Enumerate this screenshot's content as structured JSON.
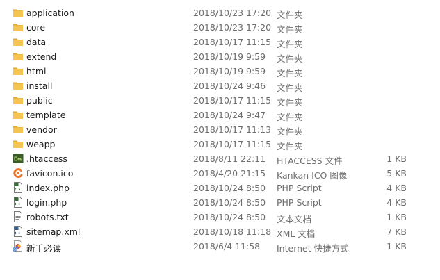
{
  "files": [
    {
      "name": "application",
      "date": "2018/10/23 17:20",
      "type": "文件夹",
      "size": "",
      "icon": "folder-icon"
    },
    {
      "name": "core",
      "date": "2018/10/23 17:20",
      "type": "文件夹",
      "size": "",
      "icon": "folder-icon"
    },
    {
      "name": "data",
      "date": "2018/10/17 11:15",
      "type": "文件夹",
      "size": "",
      "icon": "folder-icon"
    },
    {
      "name": "extend",
      "date": "2018/10/19 9:59",
      "type": "文件夹",
      "size": "",
      "icon": "folder-icon"
    },
    {
      "name": "html",
      "date": "2018/10/19 9:59",
      "type": "文件夹",
      "size": "",
      "icon": "folder-icon"
    },
    {
      "name": "install",
      "date": "2018/10/24 9:46",
      "type": "文件夹",
      "size": "",
      "icon": "folder-icon"
    },
    {
      "name": "public",
      "date": "2018/10/17 11:15",
      "type": "文件夹",
      "size": "",
      "icon": "folder-icon"
    },
    {
      "name": "template",
      "date": "2018/10/24 9:47",
      "type": "文件夹",
      "size": "",
      "icon": "folder-icon"
    },
    {
      "name": "vendor",
      "date": "2018/10/17 11:13",
      "type": "文件夹",
      "size": "",
      "icon": "folder-icon"
    },
    {
      "name": "weapp",
      "date": "2018/10/17 11:15",
      "type": "文件夹",
      "size": "",
      "icon": "folder-icon"
    },
    {
      "name": ".htaccess",
      "date": "2018/8/11 22:11",
      "type": "HTACCESS 文件",
      "size": "1 KB",
      "icon": "dreamweaver-icon"
    },
    {
      "name": "favicon.ico",
      "date": "2018/4/20 21:15",
      "type": "Kankan ICO 图像",
      "size": "5 KB",
      "icon": "kankan-icon"
    },
    {
      "name": "index.php",
      "date": "2018/10/24 8:50",
      "type": "PHP Script",
      "size": "4 KB",
      "icon": "php-file-icon"
    },
    {
      "name": "login.php",
      "date": "2018/10/24 8:50",
      "type": "PHP Script",
      "size": "4 KB",
      "icon": "php-file-icon"
    },
    {
      "name": "robots.txt",
      "date": "2018/10/24 8:50",
      "type": "文本文档",
      "size": "1 KB",
      "icon": "text-file-icon"
    },
    {
      "name": "sitemap.xml",
      "date": "2018/10/18 11:18",
      "type": "XML 文档",
      "size": "7 KB",
      "icon": "xml-file-icon"
    },
    {
      "name": "新手必读",
      "date": "2018/6/4 11:58",
      "type": "Internet 快捷方式",
      "size": "1 KB",
      "icon": "internet-shortcut-icon"
    }
  ],
  "colors": {
    "folder": "#f5c451",
    "folder_dark": "#e3a92b",
    "dreamweaver_bg": "#3b5b2a",
    "dreamweaver_text": "#b8e07a",
    "kankan": "#e8742a",
    "text_secondary": "#6d6d6d",
    "hover": "#e5f3ff"
  }
}
